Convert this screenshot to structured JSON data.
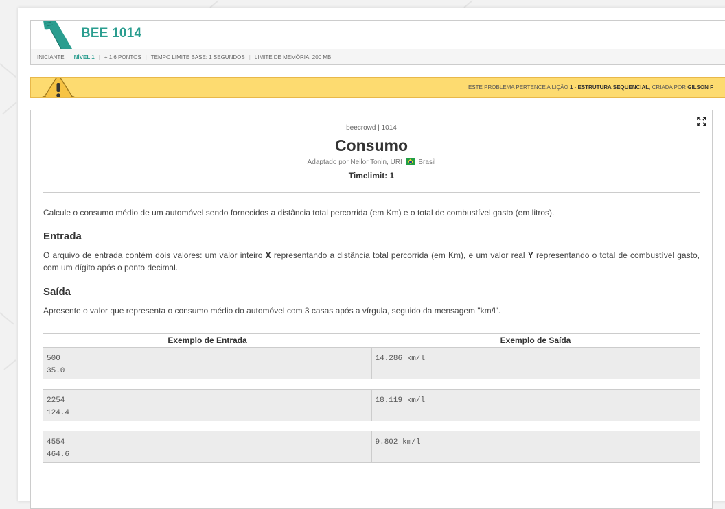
{
  "header": {
    "title": "BEE 1014",
    "meta": {
      "category": "INICIANTE",
      "level": "NÍVEL 1",
      "points": "+ 1.6 PONTOS",
      "time_limit": "TEMPO LIMITE BASE: 1 SEGUNDOS",
      "memory_limit": "LIMITE DE MEMÓRIA: 200 MB"
    }
  },
  "notice": {
    "prefix": "ESTE PROBLEMA PERTENCE A LIÇÃO",
    "lesson": "1 - ESTRUTURA SEQUENCIAL",
    "created_by": ", CRIADA POR",
    "author": "GILSON F"
  },
  "problem": {
    "origin": "beecrowd | 1014",
    "title": "Consumo",
    "adapted_by": "Adaptado por Neilor Tonin, URI",
    "country": "Brasil",
    "timelimit": "Timelimit: 1",
    "description": "Calcule o consumo médio de um automóvel sendo fornecidos a distância total percorrida (em Km) e o total de combustível gasto (em litros).",
    "input_title": "Entrada",
    "input_text": {
      "t1": "O arquivo de entrada contém dois valores: um valor inteiro",
      "var_x": "X",
      "t2": "representando a distância total percorrida (em Km), e um valor real",
      "var_y": "Y",
      "t3": "representando o total de combustível gasto, com um dígito após o ponto decimal."
    },
    "output_title": "Saída",
    "output_text": "Apresente o valor que representa o consumo médio do automóvel com 3 casas após a vírgula, seguido da mensagem \"km/l\"."
  },
  "examples": {
    "input_header": "Exemplo de Entrada",
    "output_header": "Exemplo de Saída",
    "rows": [
      {
        "input": "500\n35.0",
        "output": "14.286 km/l"
      },
      {
        "input": "2254\n124.4",
        "output": "18.119 km/l"
      },
      {
        "input": "4554\n464.6",
        "output": "9.802 km/l"
      }
    ]
  },
  "icons": {
    "logo": "beecrowd-logo-icon",
    "warning": "warning-icon",
    "expand": "expand-icon",
    "flag": "brazil-flag-icon"
  },
  "colors": {
    "accent": "#2a9d8f",
    "notice_bg": "#fddb70",
    "example_bg": "#ececec"
  }
}
